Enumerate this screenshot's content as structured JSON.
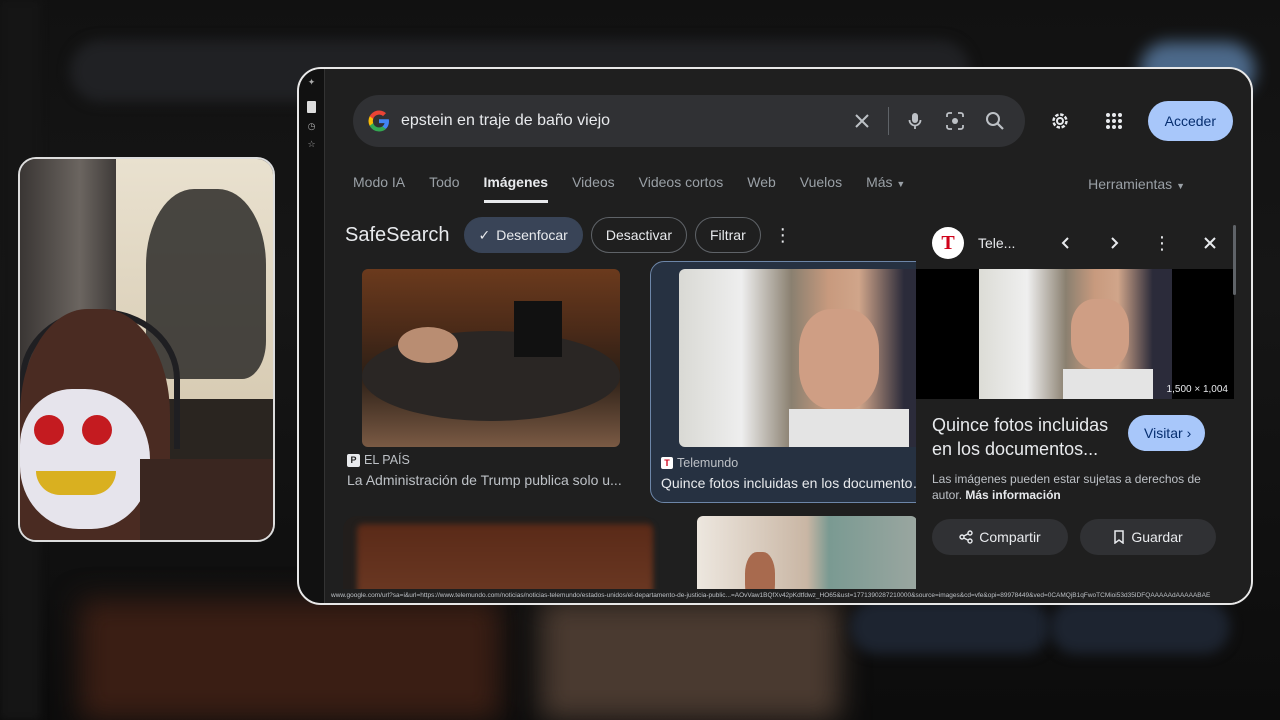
{
  "search": {
    "query": "epstein en traje de baño viejo"
  },
  "header": {
    "signin_label": "Acceder",
    "icons": [
      "settings-icon",
      "apps-grid-icon"
    ]
  },
  "tabs": [
    {
      "label": "Modo IA",
      "active": false
    },
    {
      "label": "Todo",
      "active": false
    },
    {
      "label": "Imágenes",
      "active": true
    },
    {
      "label": "Videos",
      "active": false
    },
    {
      "label": "Videos cortos",
      "active": false
    },
    {
      "label": "Web",
      "active": false
    },
    {
      "label": "Vuelos",
      "active": false
    },
    {
      "label": "Más",
      "active": false
    }
  ],
  "tools_label": "Herramientas",
  "safesearch": {
    "label": "SafeSearch",
    "options": [
      "Desenfocar",
      "Desactivar",
      "Filtrar"
    ],
    "selected": "Desenfocar"
  },
  "results": [
    {
      "source": "EL PAÍS",
      "title": "La Administración de Trump publica solo u..."
    },
    {
      "source": "Telemundo",
      "title": "Quince fotos incluidas en los documentos..."
    }
  ],
  "panel": {
    "source": "Tele...",
    "dimensions": "1,500 × 1,004",
    "title": "Quince fotos incluidas en los documentos...",
    "visit_label": "Visitar",
    "note": "Las imágenes pueden estar sujetas a derechos de autor.",
    "more_info": "Más información",
    "share_label": "Compartir",
    "save_label": "Guardar"
  },
  "status_url": "www.google.com/url?sa=i&url=https://www.telemundo.com/noticias/noticias-telemundo/estados-unidos/el-departamento-de-justicia-public...=AOvVaw1BQfXv42pKdtfdwz_HO65&ust=1771390287210000&source=images&cd=vfe&opi=89978449&ved=0CAMQjB1qFwoTCMioi53d35IDFQAAAAAdAAAAABAE",
  "colors": {
    "accent_button": "#a8c7fa",
    "selected_chip": "#394457",
    "page_bg": "#1f1f1f",
    "searchbar_bg": "#303134"
  }
}
